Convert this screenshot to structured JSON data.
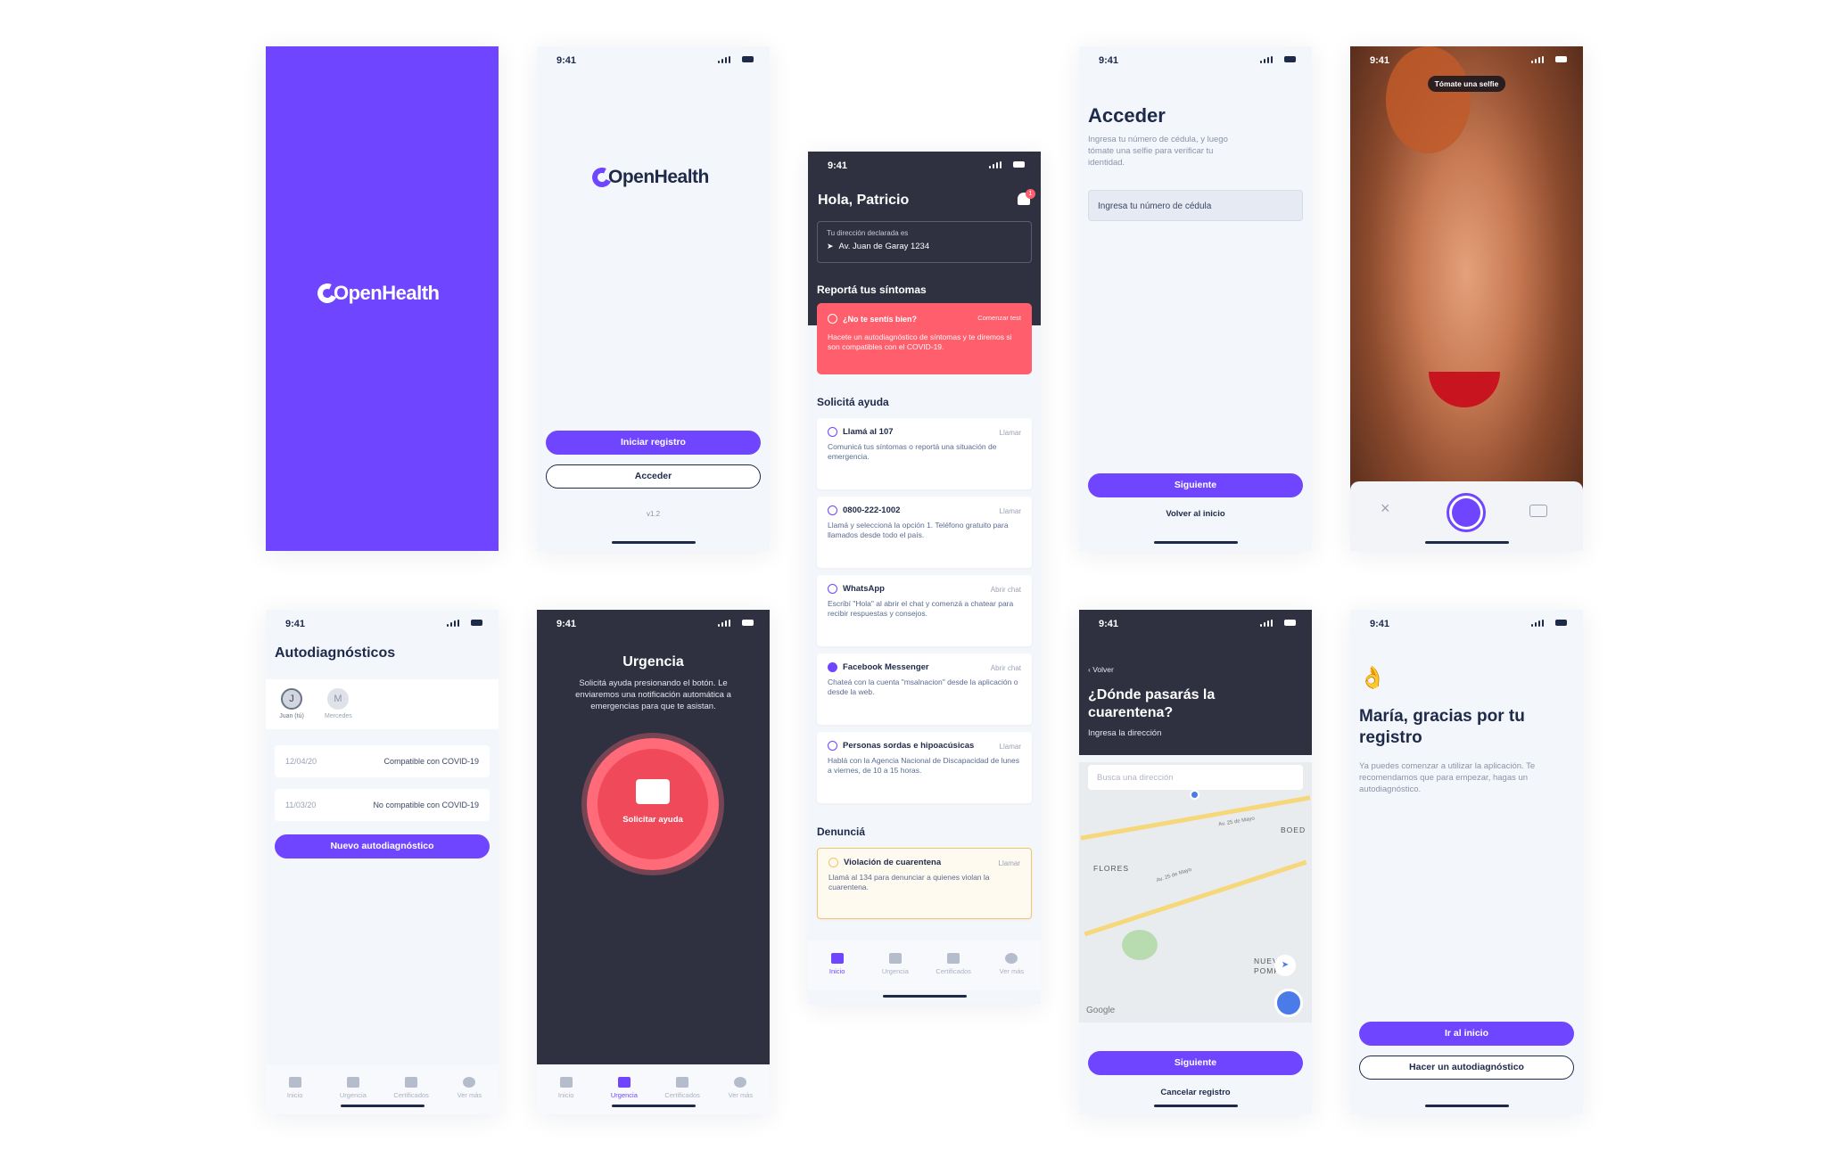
{
  "colors": {
    "brand": "#6f45ff",
    "dark": "#2f3140",
    "alert": "#ff5f6d",
    "warn": "#f2c46b"
  },
  "splash": {
    "logo": "OpenHealth"
  },
  "welcome": {
    "time": "9:41",
    "logo": "OpenHealth",
    "primary": "Iniciar registro",
    "secondary": "Acceder",
    "version": "v1.2"
  },
  "home": {
    "time": "9:41",
    "greeting": "Hola, Patricio",
    "notification_count": "1",
    "address_label": "Tu dirección declarada es",
    "address": "Av. Juan de Garay 1234",
    "symptoms_heading": "Reportá tus síntomas",
    "symptoms_card": {
      "title": "¿No te sentís bien?",
      "action": "Comenzar test",
      "desc": "Hacete un autodiagnóstico de síntomas y te diremos si son compatibles con el COVID-19."
    },
    "help_heading": "Solicitá ayuda",
    "help_items": [
      {
        "title": "Llamá al 107",
        "action": "Llamar",
        "desc": "Comunicá tus síntomas o reportá una situación de emergencia."
      },
      {
        "title": "0800-222-1002",
        "action": "Llamar",
        "desc": "Llamá y seleccioná la opción 1. Teléfono gratuito para llamados desde todo el país."
      },
      {
        "title": "WhatsApp",
        "action": "Abrir chat",
        "desc": "Escribí \"Hola\" al abrir el chat y comenzá a chatear para recibir respuestas y consejos."
      },
      {
        "title": "Facebook Messenger",
        "action": "Abrir chat",
        "desc": "Chateá con la cuenta \"msalnacion\" desde la aplicación o desde la web."
      },
      {
        "title": "Personas sordas e hipoacúsicas",
        "action": "Llamar",
        "desc": "Hablá con la Agencia Nacional de Discapacidad de lunes a viernes, de 10 a 15 horas."
      }
    ],
    "report_heading": "Denunciá",
    "report_card": {
      "title": "Violación de cuarentena",
      "action": "Llamar",
      "desc": "Llamá al 134 para denunciar a quienes violan la cuarentena."
    }
  },
  "tabs": [
    "Inicio",
    "Urgencia",
    "Certificados",
    "Ver más"
  ],
  "acceder": {
    "time": "9:41",
    "title": "Acceder",
    "desc": "Ingresa tu número de cédula, y luego tómate una selfie para verificar tu identidad.",
    "placeholder": "Ingresa tu número de cédula",
    "primary": "Siguiente",
    "secondary": "Volver al inicio"
  },
  "selfie": {
    "time": "9:41",
    "hint": "Tómate una selfie"
  },
  "autodiag": {
    "time": "9:41",
    "title": "Autodiagnósticos",
    "people": [
      {
        "initial": "J",
        "name": "Juan (tú)"
      },
      {
        "initial": "M",
        "name": "Mercedes"
      }
    ],
    "entries": [
      {
        "date": "12/04/20",
        "result": "Compatible con COVID-19"
      },
      {
        "date": "11/03/20",
        "result": "No compatible con COVID-19"
      }
    ],
    "button": "Nuevo autodiagnóstico"
  },
  "urgencia": {
    "time": "9:41",
    "title": "Urgencia",
    "desc": "Solicitá ayuda presionando el botón. Le enviaremos una notificación automática a emergencias para que te asistan.",
    "button": "Solicitar ayuda"
  },
  "direccion": {
    "time": "9:41",
    "back": "Volver",
    "title": "¿Dónde pasarás la cuarentena?",
    "subtitle": "Ingresa la dirección",
    "placeholder": "Busca una dirección",
    "map_labels": [
      "FLORES",
      "BOED",
      "NUEVA POMP",
      "Av. 25 de Mayo",
      "Av. 25 de Mayo"
    ],
    "map_brand": "Google",
    "primary": "Siguiente",
    "secondary": "Cancelar registro"
  },
  "gracias": {
    "time": "9:41",
    "title": "María, gracias por tu registro",
    "desc": "Ya puedes comenzar a utilizar la aplicación. Te recomendamos que para empezar, hagas un autodiagnóstico.",
    "primary": "Ir al inicio",
    "secondary": "Hacer un autodiagnóstico"
  }
}
